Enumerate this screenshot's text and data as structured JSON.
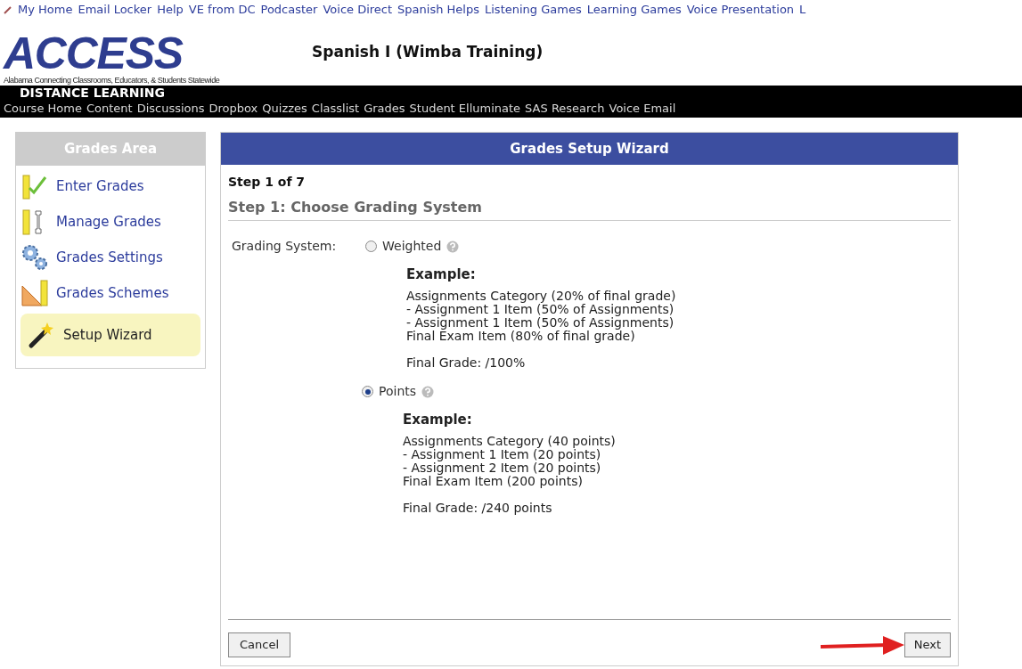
{
  "top_links": [
    "My Home",
    "Email Locker",
    "Help",
    "VE from DC",
    "Podcaster",
    "Voice Direct",
    "Spanish Helps",
    "Listening Games",
    "Learning Games",
    "Voice Presentation",
    "L"
  ],
  "logo": {
    "wordmark": "ACCESS",
    "tagline": "Alabama Connecting Classrooms, Educators, & Students Statewide",
    "subtitle": "DISTANCE LEARNING"
  },
  "course_title": "Spanish I (Wimba Training)",
  "nav_links": [
    "Course Home",
    "Content",
    "Discussions",
    "Dropbox",
    "Quizzes",
    "Classlist",
    "Grades",
    "Student Elluminate",
    "SAS Research",
    "Voice Email"
  ],
  "sidebar": {
    "title": "Grades Area",
    "items": [
      {
        "kind": "enter",
        "label": "Enter Grades",
        "selected": false
      },
      {
        "kind": "manage",
        "label": "Manage Grades",
        "selected": false
      },
      {
        "kind": "settings",
        "label": "Grades Settings",
        "selected": false
      },
      {
        "kind": "schemes",
        "label": "Grades Schemes",
        "selected": false
      },
      {
        "kind": "wizard",
        "label": "Setup Wizard",
        "selected": true
      }
    ]
  },
  "wizard": {
    "title": "Grades Setup Wizard",
    "step": "Step 1 of 7",
    "heading": "Step 1: Choose Grading System",
    "field_label": "Grading System:",
    "options": [
      {
        "label": "Weighted",
        "selected": false,
        "example_title": "Example:",
        "example_lines": [
          "Assignments Category (20% of final grade)",
          "- Assignment 1 Item (50% of Assignments)",
          "- Assignment 1 Item (50% of Assignments)",
          "Final Exam Item (80% of final grade)"
        ],
        "final": "Final Grade: /100%"
      },
      {
        "label": "Points",
        "selected": true,
        "example_title": "Example:",
        "example_lines": [
          "Assignments Category (40 points)",
          "- Assignment 1 Item (20 points)",
          "- Assignment 2 Item (20 points)",
          "Final Exam Item (200 points)"
        ],
        "final": "Final Grade: /240 points"
      }
    ],
    "buttons": {
      "cancel": "Cancel",
      "next": "Next"
    }
  }
}
